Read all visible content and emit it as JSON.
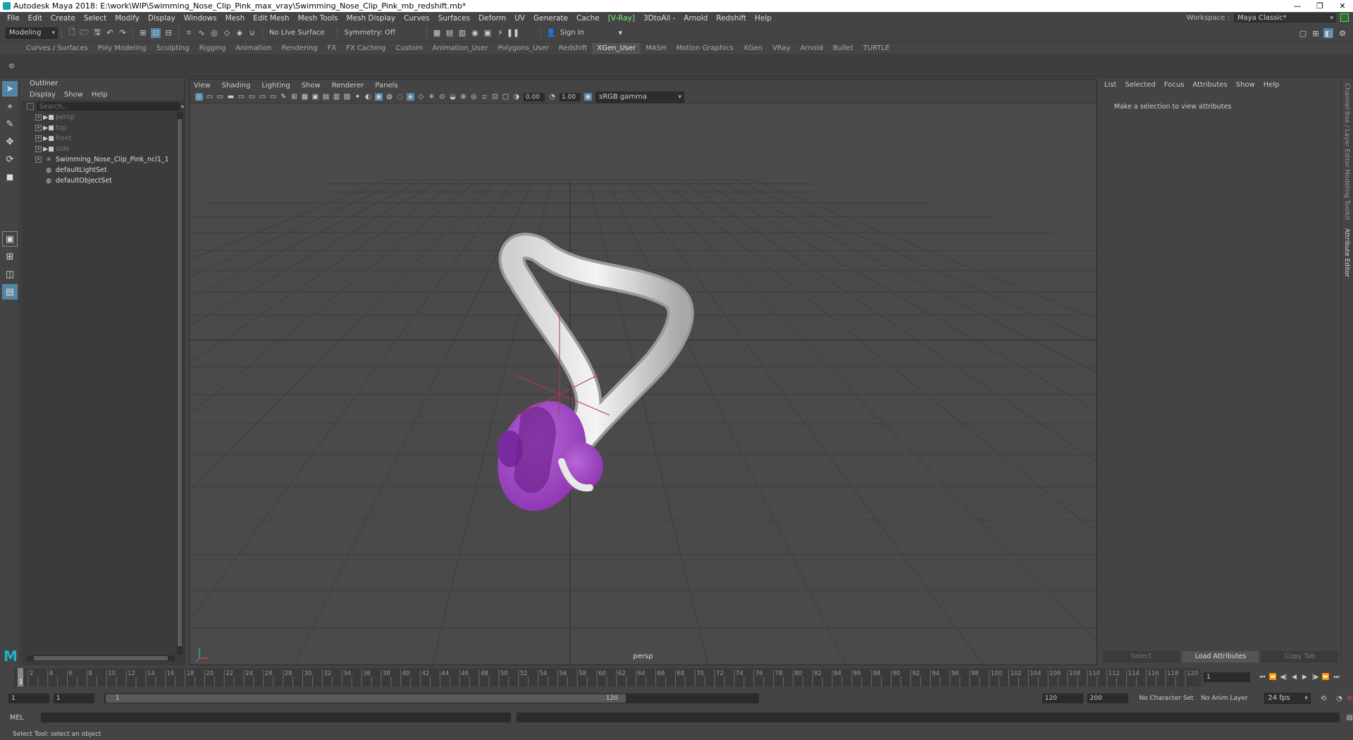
{
  "window": {
    "title": "Autodesk Maya 2018: E:\\work\\WIP\\Swimming_Nose_Clip_Pink_max_vray\\Swimming_Nose_Clip_Pink_mb_redshift.mb*",
    "minimize": "—",
    "maximize": "❐",
    "close": "✕"
  },
  "menubar": {
    "items": [
      "File",
      "Edit",
      "Create",
      "Select",
      "Modify",
      "Display",
      "Windows",
      "Mesh",
      "Edit Mesh",
      "Mesh Tools",
      "Mesh Display",
      "Curves",
      "Surfaces",
      "Deform",
      "UV",
      "Generate",
      "Cache",
      "[V-Ray]",
      "3DtoAll -",
      "Arnold",
      "Redshift",
      "Help"
    ],
    "workspace_label": "Workspace :",
    "workspace_value": "Maya Classic*"
  },
  "statusline": {
    "mode": "Modeling",
    "live_surface": "No Live Surface",
    "symmetry": "Symmetry: Off",
    "sign_in": "Sign In"
  },
  "shelf": {
    "tabs": [
      "Curves / Surfaces",
      "Poly Modeling",
      "Sculpting",
      "Rigging",
      "Animation",
      "Rendering",
      "FX",
      "FX Caching",
      "Custom",
      "Animation_User",
      "Polygons_User",
      "Redshift",
      "XGen_User",
      "MASH",
      "Motion Graphics",
      "XGen",
      "VRay",
      "Arnold",
      "Bullet",
      "TURTLE"
    ],
    "active_tab": "XGen_User"
  },
  "outliner": {
    "title": "Outliner",
    "menu": [
      "Display",
      "Show",
      "Help"
    ],
    "search_placeholder": "Search...",
    "items": [
      {
        "label": "persp",
        "type": "camera",
        "dim": true
      },
      {
        "label": "top",
        "type": "camera",
        "dim": true
      },
      {
        "label": "front",
        "type": "camera",
        "dim": true
      },
      {
        "label": "side",
        "type": "camera",
        "dim": true
      },
      {
        "label": "Swimming_Nose_Clip_Pink_ncl1_1",
        "type": "group",
        "dim": false
      },
      {
        "label": "defaultLightSet",
        "type": "set",
        "dim": false
      },
      {
        "label": "defaultObjectSet",
        "type": "set",
        "dim": false
      }
    ]
  },
  "viewport": {
    "menu": [
      "View",
      "Shading",
      "Lighting",
      "Show",
      "Renderer",
      "Panels"
    ],
    "exposure": "0.00",
    "gamma": "1.00",
    "color_space": "sRGB gamma",
    "camera": "persp",
    "colors": {
      "background": "#4a4a4a",
      "grid": "#3c3c3c",
      "clip_body": "#e8e8e8",
      "clip_pad": "#a64bc8",
      "manipulator": "#c0305a"
    }
  },
  "attribute_editor": {
    "menu": [
      "List",
      "Selected",
      "Focus",
      "Attributes",
      "Show",
      "Help"
    ],
    "message": "Make a selection to view attributes",
    "buttons": [
      "Select",
      "Load Attributes",
      "Copy Tab"
    ],
    "side_tabs": [
      "Channel Box / Layer Editor",
      "Modeling Toolkit",
      "Attribute Editor"
    ]
  },
  "timeline": {
    "current_frame": "1",
    "tick_labels": [
      "2",
      "4",
      "6",
      "8",
      "10",
      "12",
      "14",
      "16",
      "18",
      "20",
      "22",
      "24",
      "26",
      "28",
      "30",
      "32",
      "34",
      "36",
      "38",
      "40",
      "42",
      "44",
      "46",
      "48",
      "50",
      "52",
      "54",
      "56",
      "58",
      "60",
      "62",
      "64",
      "66",
      "68",
      "70",
      "72",
      "74",
      "76",
      "78",
      "80",
      "82",
      "84",
      "86",
      "88",
      "90",
      "92",
      "94",
      "96",
      "98",
      "100",
      "102",
      "104",
      "106",
      "108",
      "110",
      "112",
      "114",
      "116",
      "118",
      "120"
    ],
    "start_tick": "1"
  },
  "range": {
    "start": "1",
    "playback_start": "1",
    "slider_start": "1",
    "slider_end": "120",
    "playback_end": "120",
    "end": "200",
    "character_set": "No Character Set",
    "anim_layer": "No Anim Layer",
    "fps": "24 fps"
  },
  "command": {
    "mel_label": "MEL"
  },
  "helpline": {
    "text": "Select Tool: select an object"
  }
}
